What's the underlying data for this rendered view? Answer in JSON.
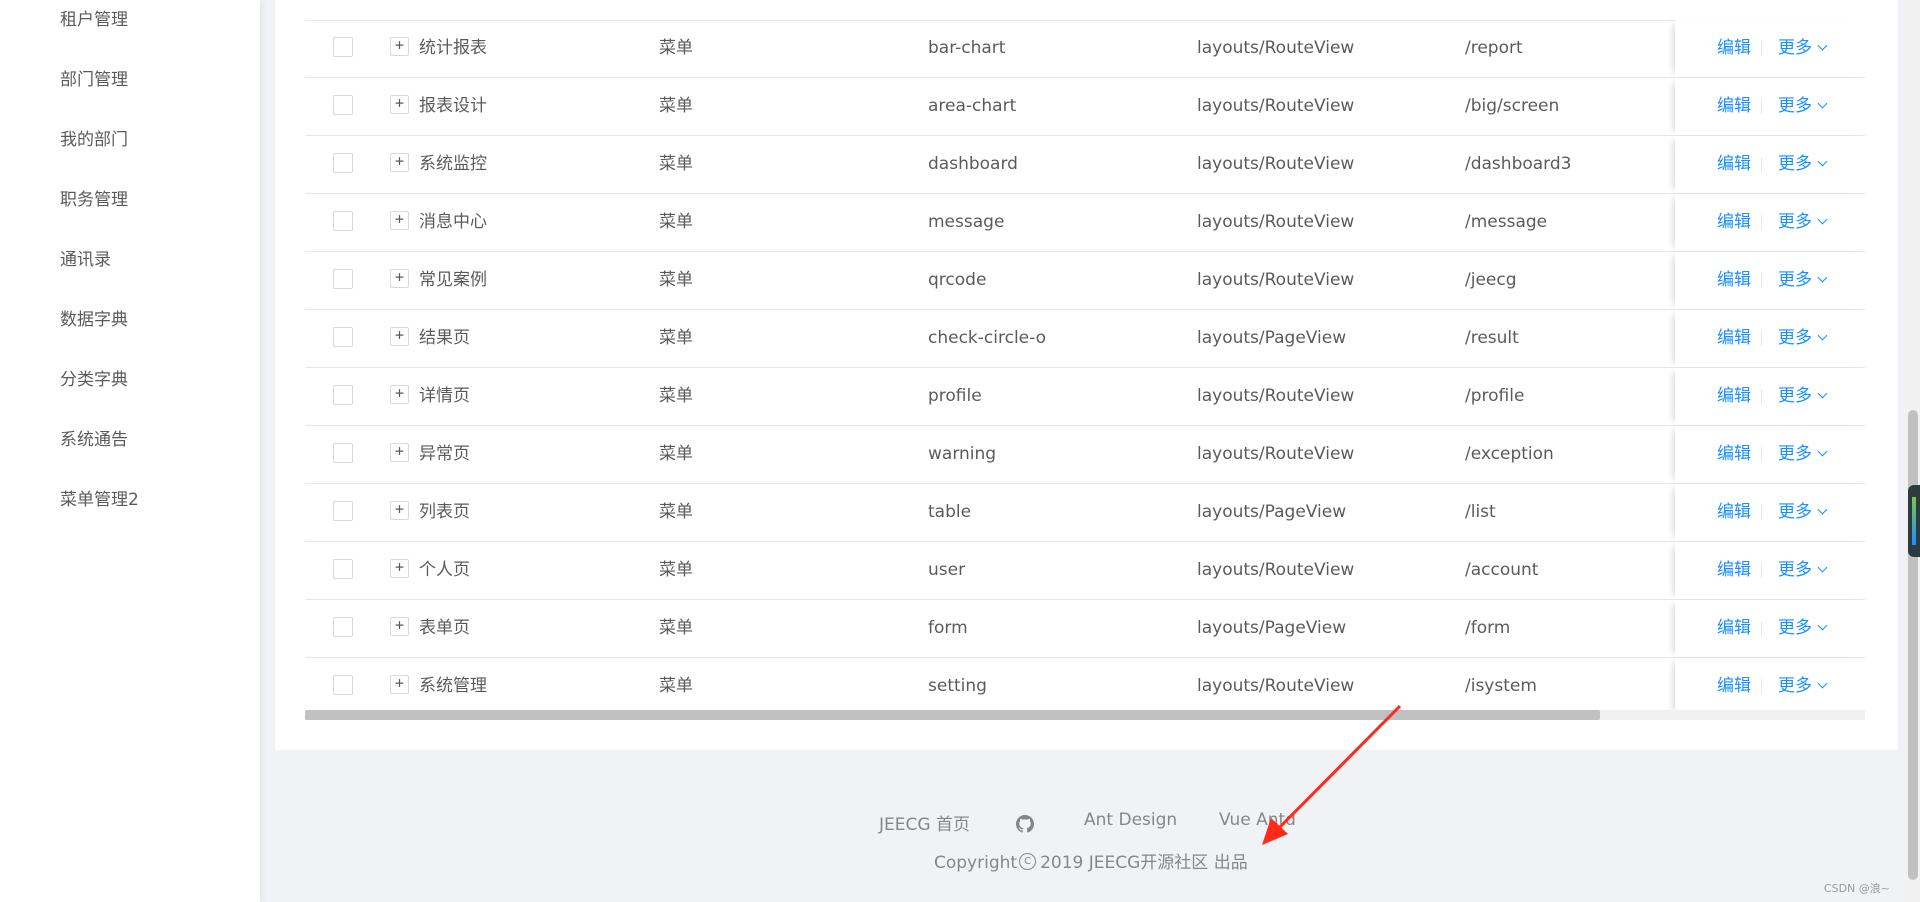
{
  "sidebar": {
    "items": [
      {
        "label": "租户管理"
      },
      {
        "label": "部门管理"
      },
      {
        "label": "我的部门"
      },
      {
        "label": "职务管理"
      },
      {
        "label": "通讯录"
      },
      {
        "label": "数据字典"
      },
      {
        "label": "分类字典"
      },
      {
        "label": "系统通告"
      },
      {
        "label": "菜单管理2"
      }
    ]
  },
  "table": {
    "rows": [
      {
        "name": "统计报表",
        "type": "菜单",
        "icon": "bar-chart",
        "component": "layouts/RouteView",
        "path": "/report"
      },
      {
        "name": "报表设计",
        "type": "菜单",
        "icon": "area-chart",
        "component": "layouts/RouteView",
        "path": "/big/screen"
      },
      {
        "name": "系统监控",
        "type": "菜单",
        "icon": "dashboard",
        "component": "layouts/RouteView",
        "path": "/dashboard3"
      },
      {
        "name": "消息中心",
        "type": "菜单",
        "icon": "message",
        "component": "layouts/RouteView",
        "path": "/message"
      },
      {
        "name": "常见案例",
        "type": "菜单",
        "icon": "qrcode",
        "component": "layouts/RouteView",
        "path": "/jeecg"
      },
      {
        "name": "结果页",
        "type": "菜单",
        "icon": "check-circle-o",
        "component": "layouts/PageView",
        "path": "/result"
      },
      {
        "name": "详情页",
        "type": "菜单",
        "icon": "profile",
        "component": "layouts/RouteView",
        "path": "/profile"
      },
      {
        "name": "异常页",
        "type": "菜单",
        "icon": "warning",
        "component": "layouts/RouteView",
        "path": "/exception"
      },
      {
        "name": "列表页",
        "type": "菜单",
        "icon": "table",
        "component": "layouts/PageView",
        "path": "/list"
      },
      {
        "name": "个人页",
        "type": "菜单",
        "icon": "user",
        "component": "layouts/RouteView",
        "path": "/account"
      },
      {
        "name": "表单页",
        "type": "菜单",
        "icon": "form",
        "component": "layouts/PageView",
        "path": "/form"
      },
      {
        "name": "系统管理",
        "type": "菜单",
        "icon": "setting",
        "component": "layouts/RouteView",
        "path": "/isystem"
      }
    ],
    "edit_label": "编辑",
    "more_label": "更多",
    "expand_glyph": "+",
    "scroll_fraction": 0.83
  },
  "footer": {
    "links": [
      {
        "label": "JEECG 首页"
      },
      {
        "label": "Ant Design"
      },
      {
        "label": "Vue Antd"
      }
    ],
    "copyright_prefix": "Copyright",
    "copyright_suffix": "2019 JEECG开源社区 出品"
  },
  "watermark": "CSDN @浪~",
  "colors": {
    "link": "#1890ff",
    "arrow": "#ff2a1a"
  }
}
